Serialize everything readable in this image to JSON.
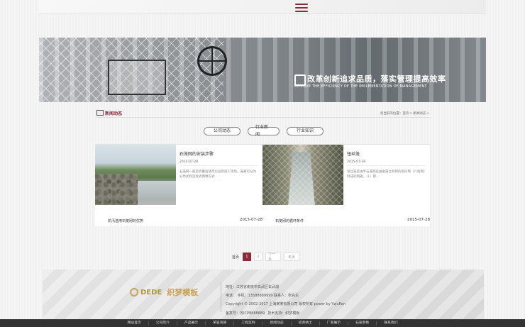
{
  "banner": {
    "title": "改革创新追求品质，落实管理提高效率",
    "subtitle": "IMPROVE THE EFFICIENCY OF THE IMPLEMENTATION OF MANAGEMENT"
  },
  "section": {
    "title": "新闻动态",
    "breadcrumb": {
      "prefix": "您当前的位置：",
      "home": "首页",
      "sep": ">",
      "current": "新闻动态",
      "tail": ">"
    }
  },
  "tabs": [
    "公司动态",
    "行业新闻",
    "行业知识"
  ],
  "news": [
    {
      "title": "石笼网的安装步骤",
      "date": "2015-07-28",
      "excerpt": "石笼网一般是折叠后放得包运到施工现场。笼箱可分为分坑式和连续式两种方式...",
      "foot_title": "防汛选用石笼网的优势",
      "foot_date": "2015-07-28"
    },
    {
      "title": "钮丝笼",
      "date": "2015-07-28",
      "excerpt": "钮丝笼是由半石笼网是由金属丝机制的角形网（六角网）制成的网箱，（1）镀...",
      "foot_title": "石笼网的循环条件",
      "foot_date": "2015-07-28"
    }
  ],
  "pagination": {
    "first": "首页",
    "pages": [
      "1",
      "2"
    ],
    "next": "下一页",
    "last": "末页",
    "current": "1"
  },
  "footer": {
    "brand": "DEDE",
    "brand_cn": "织梦模板",
    "address": "地址：江苏省南京市玄武区玄武湖",
    "phone": "电话： 手机：13588889999 联系人：张先生",
    "copyright": "Copyright © 2002-2017 上海某某有限公司 版权所有 power by YzjuRen",
    "icp": "备案号：苏ICP8888889",
    "support": "技术支持：织梦模板"
  },
  "bottom_nav": [
    "网站首页",
    "公司简介",
    "产品展示",
    "荣誉资质",
    "工程案例",
    "新闻动态",
    "招贤纳士",
    "厂家展示",
    "石笼参数",
    "联系我们"
  ],
  "colors": {
    "accent": "#8a2b3a",
    "gold": "#c9a35a",
    "nav_bg": "#333333"
  },
  "icons": {
    "menu": "hamburger-menu-icon",
    "section": "image-icon"
  }
}
